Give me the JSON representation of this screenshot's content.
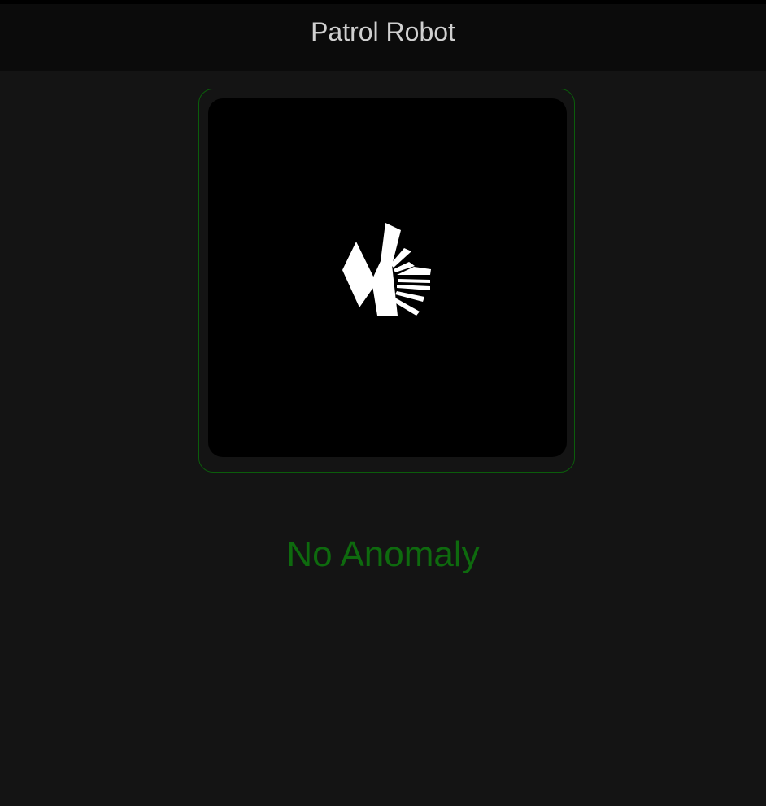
{
  "header": {
    "title": "Patrol Robot"
  },
  "map": {
    "icon": "lidar-scan-map",
    "frame_color": "#0b5d0b",
    "background": "#000000",
    "scan_color": "#ffffff"
  },
  "status": {
    "text": "No Anomaly",
    "color": "#0e6a0e"
  }
}
